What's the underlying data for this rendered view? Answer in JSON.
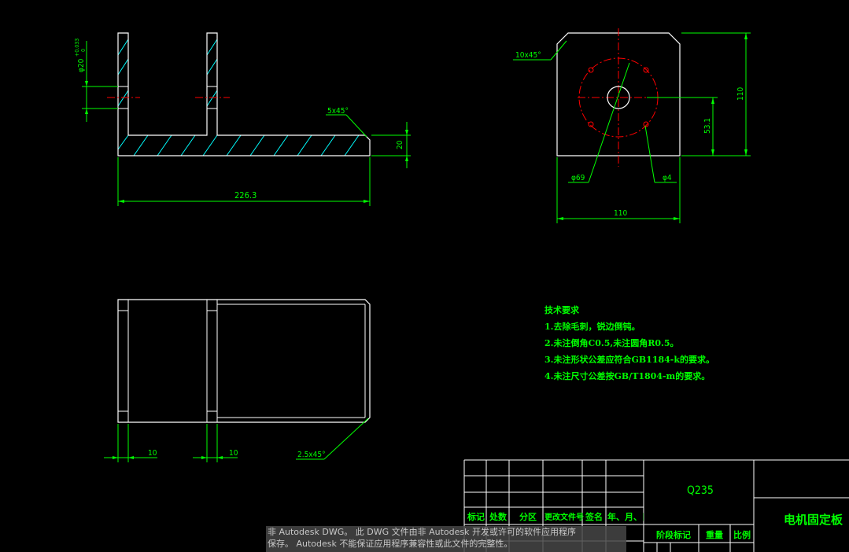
{
  "drawing": {
    "front_view": {
      "dim_length": "226.3",
      "dim_height": "20",
      "dim_chamfer": "5x45°",
      "dim_bore": "φ20",
      "dim_bore_tol_upper": "+0.033",
      "dim_bore_tol_lower": "0"
    },
    "side_view": {
      "dim_chamfer": "10x45°",
      "dim_width": "110",
      "dim_height": "110",
      "dim_center": "53.1",
      "dim_pcd": "φ69",
      "dim_hole": "φ4"
    },
    "top_view": {
      "dim_left": "10",
      "dim_right": "10",
      "dim_chamfer": "2.5x45°"
    },
    "tech_requirements": {
      "title": "技术要求",
      "items": [
        "1.去除毛刺，锐边倒钝。",
        "2.未注倒角C0.5,未注圆角R0.5。",
        "3.未注形状公差应符合GB1184-k的要求。",
        "4.未注尺寸公差按GB/T1804-m的要求。"
      ]
    },
    "title_block": {
      "material": "Q235",
      "part_name": "电机固定板",
      "col_mark": "标记",
      "col_count": "处数",
      "col_zone": "分区",
      "col_doc": "更改文件号",
      "col_sign": "签名",
      "col_date": "年、月、日",
      "col_stage": "阶段标记",
      "col_weight": "重量",
      "col_scale": "比例"
    }
  },
  "watermark": {
    "line1": "非 Autodesk DWG。  此 DWG 文件由非 Autodesk 开发或许可的软件应用程序",
    "line2": "保存。  Autodesk 不能保证应用程序兼容性或此文件的完整性。"
  }
}
